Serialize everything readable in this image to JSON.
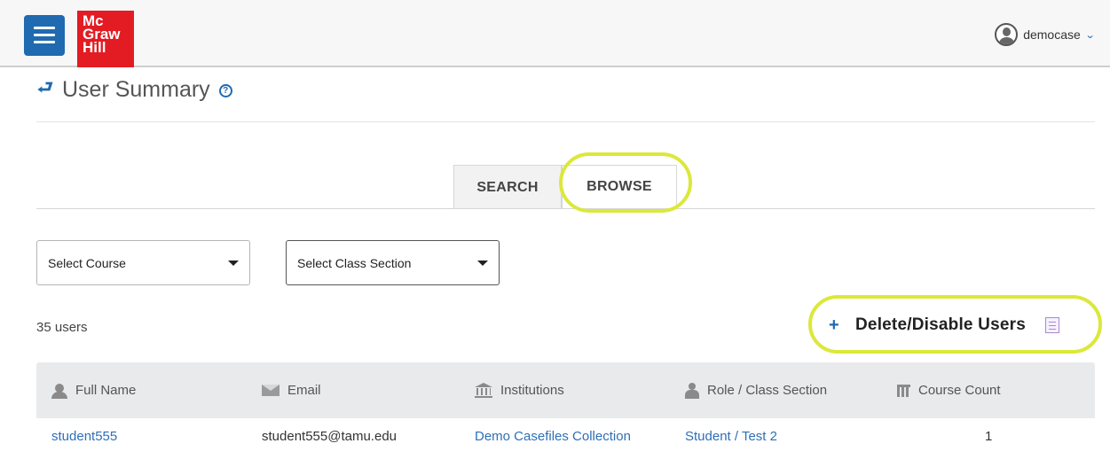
{
  "header": {
    "logo_lines": [
      "Mc",
      "Graw",
      "Hill"
    ],
    "username": "democase",
    "menu_icon": "hamburger-icon",
    "user_icon": "user-avatar-icon",
    "dropdown_icon": "chevron-down-icon"
  },
  "page": {
    "title": "User Summary",
    "back_icon": "back-arrow-icon",
    "help_icon": "help-circle-icon"
  },
  "tabs": [
    {
      "label": "SEARCH",
      "active": false
    },
    {
      "label": "BROWSE",
      "active": true
    }
  ],
  "filters": {
    "course": {
      "selected": "Select Course"
    },
    "class_section": {
      "selected": "Select Class Section"
    }
  },
  "summary": {
    "user_count": "35 users",
    "delete_action": "Delete/Disable Users"
  },
  "table": {
    "columns": [
      {
        "label": "Full Name",
        "icon": "person-icon"
      },
      {
        "label": "Email",
        "icon": "envelope-icon"
      },
      {
        "label": "Institutions",
        "icon": "institution-icon"
      },
      {
        "label": "Role / Class Section",
        "icon": "role-icon"
      },
      {
        "label": "Course Count",
        "icon": "calculator-icon"
      }
    ],
    "rows": [
      {
        "full_name": "student555",
        "email": "student555@tamu.edu",
        "institution": "Demo Casefiles Collection",
        "role_section": "Student / Test 2",
        "course_count": "1"
      }
    ]
  },
  "colors": {
    "brand_blue": "#1f6ab0",
    "logo_red": "#e31b23",
    "highlight_yellow": "#dbe83a",
    "link_blue": "#2e6fb7"
  }
}
